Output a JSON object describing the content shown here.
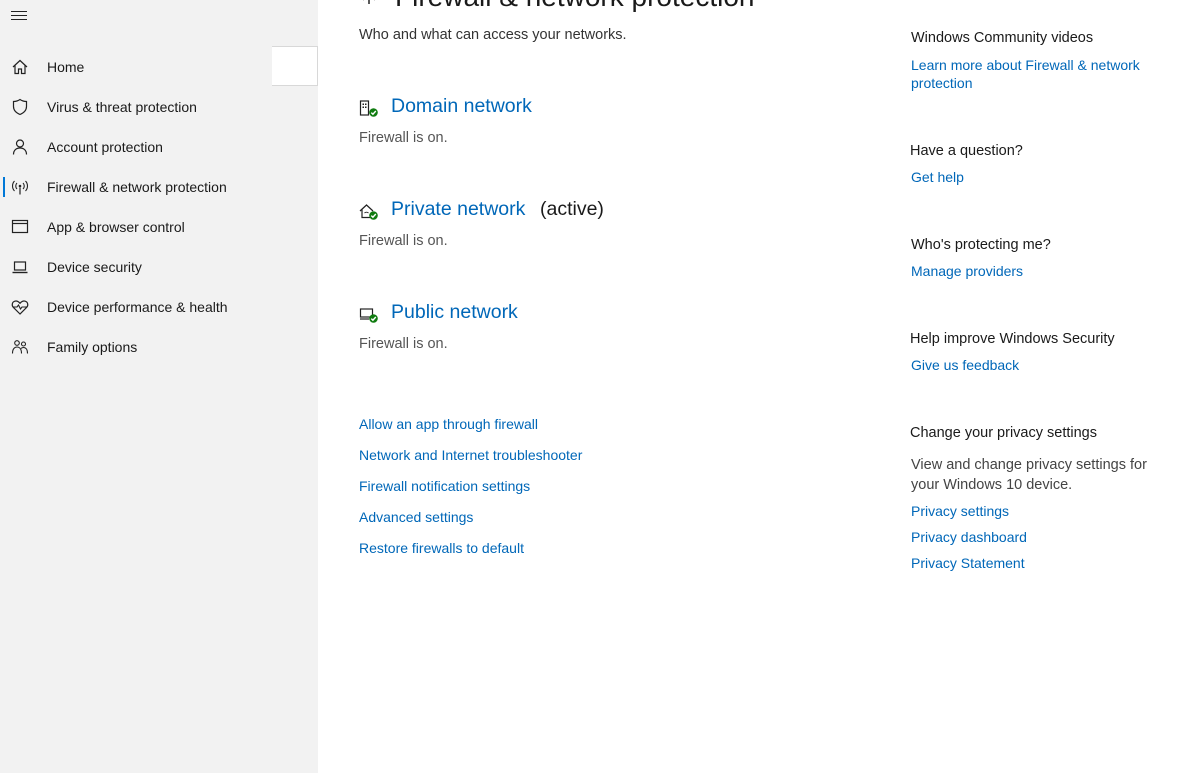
{
  "sidebar": {
    "menu_icon": "hamburger-icon",
    "items": [
      {
        "label": "Home",
        "icon": "home-icon"
      },
      {
        "label": "Virus & threat protection",
        "icon": "shield-icon"
      },
      {
        "label": "Account protection",
        "icon": "person-icon"
      },
      {
        "label": "Firewall & network protection",
        "icon": "antenna-icon",
        "active": true
      },
      {
        "label": "App & browser control",
        "icon": "browser-window-icon"
      },
      {
        "label": "Device security",
        "icon": "laptop-icon"
      },
      {
        "label": "Device performance & health",
        "icon": "heart-pulse-icon"
      },
      {
        "label": "Family options",
        "icon": "family-icon"
      }
    ]
  },
  "main": {
    "title": "Firewall & network protection",
    "subtitle": "Who and what can access your networks.",
    "networks": [
      {
        "name": "Domain network",
        "status": "Firewall is on.",
        "active_label": ""
      },
      {
        "name": "Private network",
        "status": "Firewall is on.",
        "active_label": "(active)"
      },
      {
        "name": "Public network",
        "status": "Firewall is on.",
        "active_label": ""
      }
    ],
    "links": [
      "Allow an app through firewall",
      "Network and Internet troubleshooter",
      "Firewall notification settings",
      "Advanced settings",
      "Restore firewalls to default"
    ]
  },
  "right_panel": {
    "community": {
      "heading": "Windows Community videos",
      "link": "Learn more about Firewall & network protection"
    },
    "question": {
      "heading": "Have a question?",
      "link": "Get help"
    },
    "protecting": {
      "heading": "Who's protecting me?",
      "link": "Manage providers"
    },
    "improve": {
      "heading": "Help improve Windows Security",
      "link": "Give us feedback"
    },
    "privacy": {
      "heading": "Change your privacy settings",
      "text": "View and change privacy settings for your Windows 10 device.",
      "links": [
        "Privacy settings",
        "Privacy dashboard",
        "Privacy Statement"
      ]
    }
  },
  "colors": {
    "accent": "#0067b8",
    "sidebar_bg": "#f2f2f2",
    "status_green": "#107c10"
  }
}
